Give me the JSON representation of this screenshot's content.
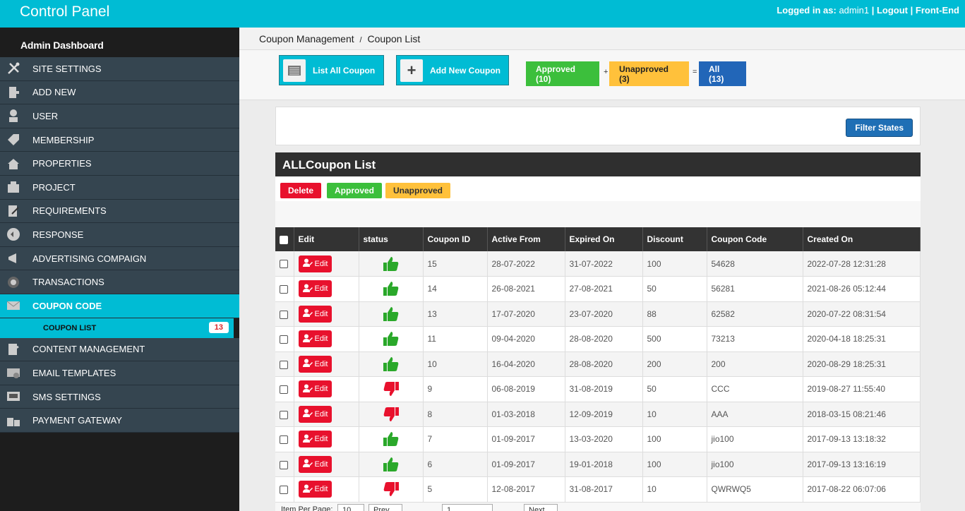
{
  "topbar": {
    "title": "Control Panel",
    "logged_label": "Logged in as:",
    "user": "admin1",
    "logout": "Logout",
    "frontend": "Front-End",
    "sep": "|"
  },
  "sidebar": {
    "dashboard": "Admin Dashboard",
    "items": [
      {
        "label": "SITE SETTINGS",
        "icon": "tools-icon"
      },
      {
        "label": "ADD NEW",
        "icon": "add-doc-icon"
      },
      {
        "label": "USER",
        "icon": "user-icon"
      },
      {
        "label": "MEMBERSHIP",
        "icon": "tag-icon"
      },
      {
        "label": "PROPERTIES",
        "icon": "home-icon"
      },
      {
        "label": "PROJECT",
        "icon": "building-icon"
      },
      {
        "label": "REQUIREMENTS",
        "icon": "edit-icon"
      },
      {
        "label": "RESPONSE",
        "icon": "reply-icon"
      },
      {
        "label": "ADVERTISING COMPAIGN",
        "icon": "megaphone-icon"
      },
      {
        "label": "TRANSACTIONS",
        "icon": "transaction-icon"
      },
      {
        "label": "COUPON CODE",
        "icon": "envelope-icon"
      },
      {
        "label": "CONTENT MANAGEMENT",
        "icon": "content-icon"
      },
      {
        "label": "EMAIL TEMPLATES",
        "icon": "mail-icon"
      },
      {
        "label": "SMS SETTINGS",
        "icon": "sms-icon"
      },
      {
        "label": "PAYMENT GATEWAY",
        "icon": "payment-icon"
      }
    ],
    "sub": {
      "label": "COUPON LIST",
      "count": "13"
    }
  },
  "breadcrumb": {
    "root": "Coupon Management",
    "sep": "/",
    "current": "Coupon List"
  },
  "toolbar": {
    "list_all": "List All Coupon",
    "add_new": "Add New Coupon",
    "approved": "Approved (10)",
    "plus": "+",
    "unapproved": "Unapproved (3)",
    "equals": "=",
    "all": "All (13)"
  },
  "filter": {
    "button": "Filter States"
  },
  "panel": {
    "title": "ALLCoupon List",
    "delete": "Delete",
    "approved": "Approved",
    "unapproved": "Unapproved",
    "columns": [
      "Edit",
      "status",
      "Coupon ID",
      "Active From",
      "Expired On",
      "Discount",
      "Coupon Code",
      "Created On"
    ],
    "edit_label": "Edit",
    "rows": [
      {
        "status": "approved",
        "id": "15",
        "from": "28-07-2022",
        "to": "31-07-2022",
        "discount": "100",
        "code": "54628",
        "created": "2022-07-28 12:31:28"
      },
      {
        "status": "approved",
        "id": "14",
        "from": "26-08-2021",
        "to": "27-08-2021",
        "discount": "50",
        "code": "56281",
        "created": "2021-08-26 05:12:44"
      },
      {
        "status": "approved",
        "id": "13",
        "from": "17-07-2020",
        "to": "23-07-2020",
        "discount": "88",
        "code": "62582",
        "created": "2020-07-22 08:31:54"
      },
      {
        "status": "approved",
        "id": "11",
        "from": "09-04-2020",
        "to": "28-08-2020",
        "discount": "500",
        "code": "73213",
        "created": "2020-04-18 18:25:31"
      },
      {
        "status": "approved",
        "id": "10",
        "from": "16-04-2020",
        "to": "28-08-2020",
        "discount": "200",
        "code": "200",
        "created": "2020-08-29 18:25:31"
      },
      {
        "status": "unapproved",
        "id": "9",
        "from": "06-08-2019",
        "to": "31-08-2019",
        "discount": "50",
        "code": "CCC",
        "created": "2019-08-27 11:55:40"
      },
      {
        "status": "unapproved",
        "id": "8",
        "from": "01-03-2018",
        "to": "12-09-2019",
        "discount": "10",
        "code": "AAA",
        "created": "2018-03-15 08:21:46"
      },
      {
        "status": "approved",
        "id": "7",
        "from": "01-09-2017",
        "to": "13-03-2020",
        "discount": "100",
        "code": "jio100",
        "created": "2017-09-13 13:18:32"
      },
      {
        "status": "approved",
        "id": "6",
        "from": "01-09-2017",
        "to": "19-01-2018",
        "discount": "100",
        "code": "jio100",
        "created": "2017-09-13 13:16:19"
      },
      {
        "status": "unapproved",
        "id": "5",
        "from": "12-08-2017",
        "to": "31-08-2017",
        "discount": "10",
        "code": "QWRWQ5",
        "created": "2017-08-22 06:07:06"
      }
    ]
  },
  "pager": {
    "per_page_label": "Item Per Page:",
    "per_page": "10",
    "prev": "Prev",
    "page": "1",
    "next": "Next"
  },
  "colors": {
    "accent": "#00bcd4",
    "sidebar": "#354550",
    "danger": "#e8112d",
    "success": "#3cbf3c",
    "warning": "#ffc13b",
    "primary": "#1f6fb5"
  }
}
